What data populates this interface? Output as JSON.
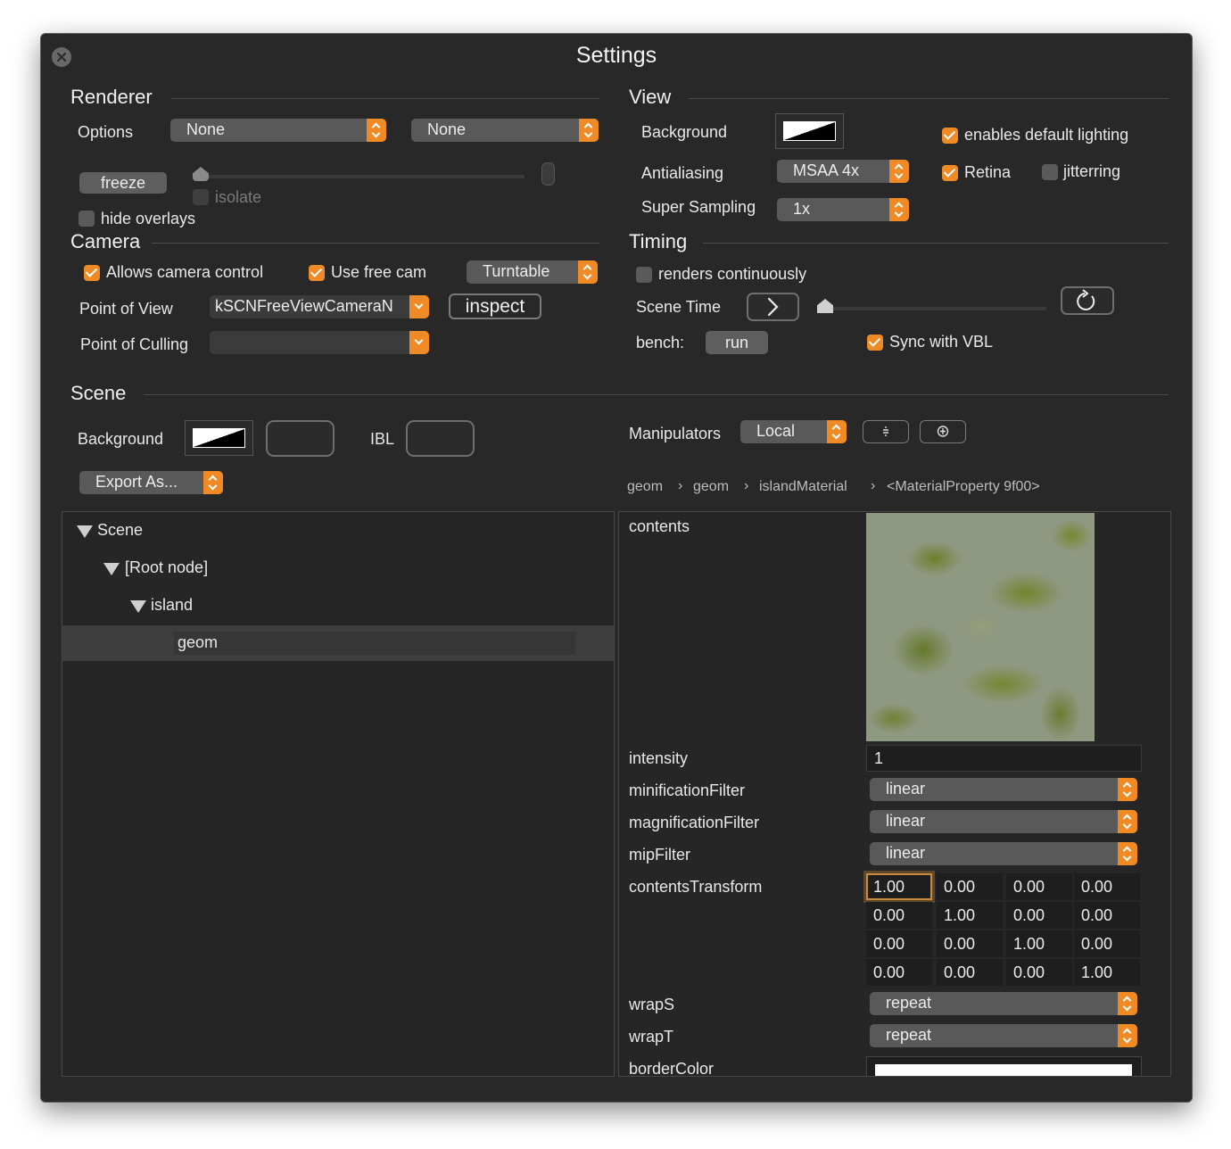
{
  "window": {
    "title": "Settings"
  },
  "renderer": {
    "heading": "Renderer",
    "options_label": "Options",
    "option1": "None",
    "option2": "None",
    "freeze_label": "freeze",
    "isolate_label": "isolate",
    "hide_overlays_label": "hide overlays"
  },
  "view": {
    "heading": "View",
    "background_label": "Background",
    "default_lighting_label": "enables default lighting",
    "antialiasing_label": "Antialiasing",
    "antialiasing_value": "MSAA 4x",
    "retina_label": "Retina",
    "jittering_label": "jitterring",
    "supersampling_label": "Super Sampling",
    "supersampling_value": "1x"
  },
  "camera": {
    "heading": "Camera",
    "allow_control_label": "Allows camera control",
    "free_cam_label": "Use free cam",
    "mode_value": "Turntable",
    "pov_label": "Point of View",
    "pov_value": "kSCNFreeViewCameraN",
    "inspect_label": "inspect",
    "culling_label": "Point of Culling",
    "culling_value": ""
  },
  "timing": {
    "heading": "Timing",
    "renders_continuously_label": "renders continuously",
    "scene_time_label": "Scene Time",
    "bench_label": "bench:",
    "run_label": "run",
    "sync_vbl_label": "Sync with VBL"
  },
  "scene": {
    "heading": "Scene",
    "background_label": "Background",
    "ibl_label": "IBL",
    "export_label": "Export As...",
    "manipulators_label": "Manipulators",
    "manipulators_value": "Local"
  },
  "breadcrumb": [
    "geom",
    "geom",
    "islandMaterial",
    "<MaterialProperty 9f00>"
  ],
  "tree": [
    {
      "label": "Scene",
      "level": 0,
      "expanded": true
    },
    {
      "label": "[Root node]",
      "level": 1,
      "expanded": true
    },
    {
      "label": "island",
      "level": 2,
      "expanded": true
    },
    {
      "label": "geom",
      "level": 3,
      "selected": true
    }
  ],
  "inspector": {
    "contents_label": "contents",
    "intensity_label": "intensity",
    "intensity_value": "1",
    "minification_label": "minificationFilter",
    "minification_value": "linear",
    "magnification_label": "magnificationFilter",
    "magnification_value": "linear",
    "mip_label": "mipFilter",
    "mip_value": "linear",
    "transform_label": "contentsTransform",
    "transform": [
      [
        "1.00",
        "0.00",
        "0.00",
        "0.00"
      ],
      [
        "0.00",
        "1.00",
        "0.00",
        "0.00"
      ],
      [
        "0.00",
        "0.00",
        "1.00",
        "0.00"
      ],
      [
        "0.00",
        "0.00",
        "0.00",
        "1.00"
      ]
    ],
    "wraps_label": "wrapS",
    "wraps_value": "repeat",
    "wrapt_label": "wrapT",
    "wrapt_value": "repeat",
    "border_label": "borderColor"
  },
  "colors": {
    "accent": "#f08a24",
    "window_bg": "#282828",
    "control": "#595959"
  }
}
